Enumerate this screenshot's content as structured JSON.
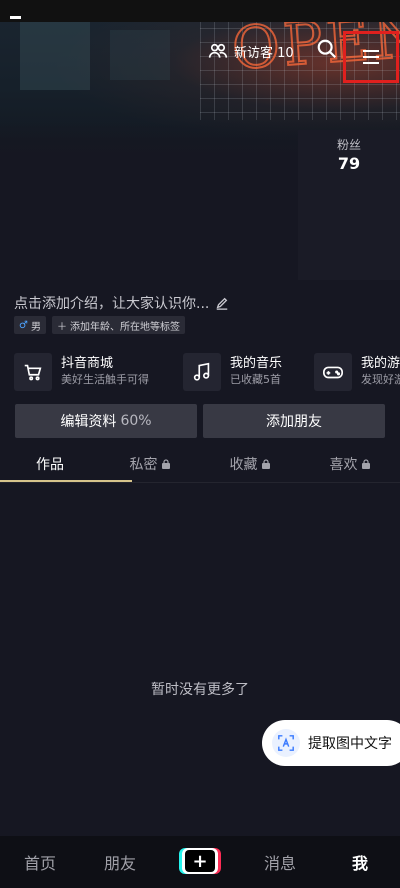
{
  "header": {
    "visitor_label": "新访客 10"
  },
  "profile": {
    "fans_label": "粉丝",
    "fans_value": "79",
    "bio_placeholder": "点击添加介绍，让大家认识你...",
    "tags": [
      {
        "label": "男"
      },
      {
        "label": "添加年龄、所在地等标签"
      }
    ]
  },
  "services": [
    {
      "title": "抖音商城",
      "subtitle": "美好生活触手可得",
      "icon": "cart-icon"
    },
    {
      "title": "我的音乐",
      "subtitle": "已收藏5首",
      "icon": "music-icon"
    },
    {
      "title": "我的游戏",
      "subtitle": "发现好游戏",
      "icon": "gamepad-icon"
    }
  ],
  "actions": {
    "edit_profile": "编辑资料",
    "edit_progress": "60%",
    "add_friend": "添加朋友"
  },
  "tabs": [
    {
      "label": "作品",
      "locked": false
    },
    {
      "label": "私密",
      "locked": true
    },
    {
      "label": "收藏",
      "locked": true
    },
    {
      "label": "喜欢",
      "locked": true
    }
  ],
  "empty_text": "暂时没有更多了",
  "ocr_button": "提取图中文字",
  "bottom_nav": {
    "home": "首页",
    "friends": "朋友",
    "plus": "+",
    "messages": "消息",
    "me": "我"
  },
  "colors": {
    "background": "#161722",
    "highlight_box": "#e0201e",
    "tab_underline": "#d6c48c"
  }
}
